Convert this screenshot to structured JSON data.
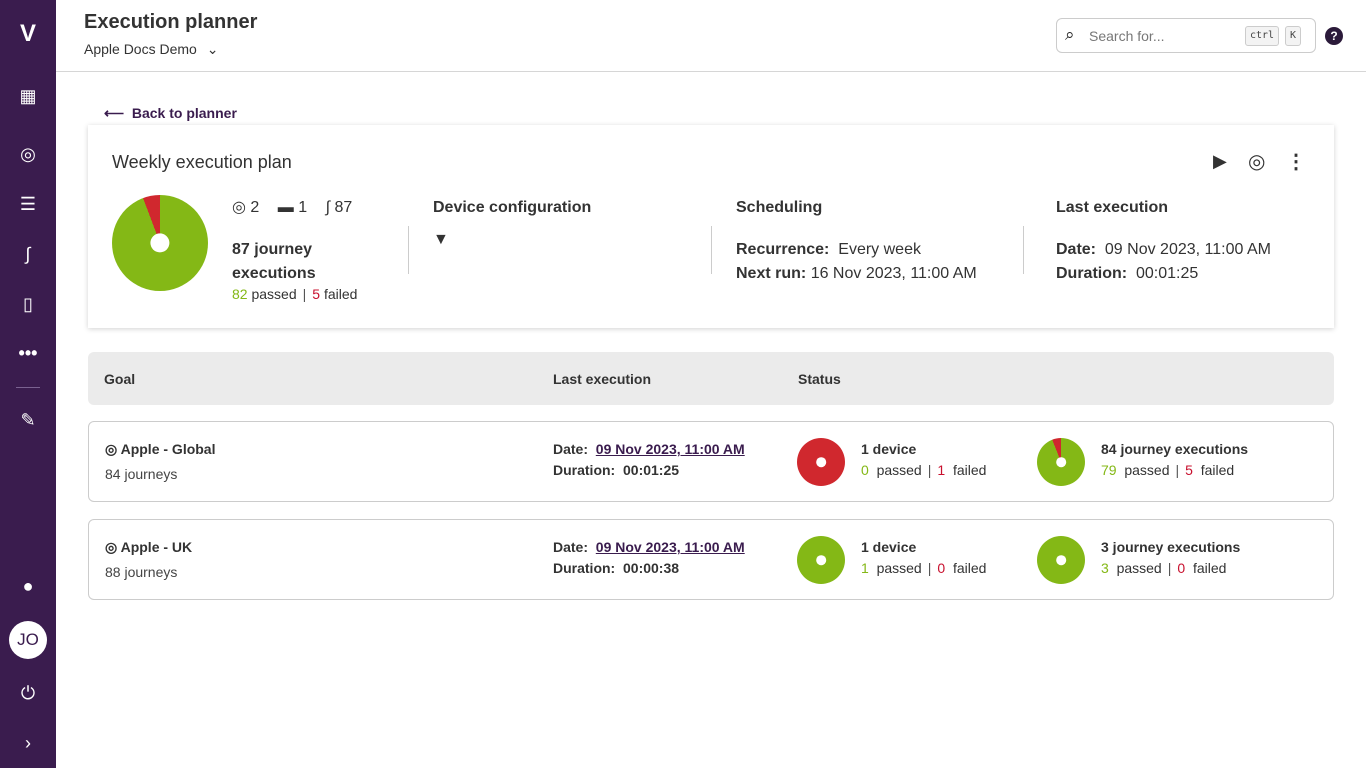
{
  "colors": {
    "sidebar": "#3a1c4e",
    "passed": "#84b816",
    "failed": "#d0282e"
  },
  "sidebar": {
    "items": [
      {
        "icon": "logo-icon"
      },
      {
        "icon": "organization-icon"
      },
      {
        "icon": "goal-icon"
      },
      {
        "icon": "list-icon"
      },
      {
        "icon": "journey-icon"
      },
      {
        "icon": "code-file-icon"
      },
      {
        "icon": "more-icon"
      },
      {
        "icon": "pin-icon"
      },
      {
        "icon": "chat-icon"
      },
      {
        "icon": "power-icon"
      },
      {
        "icon": "expand-icon"
      }
    ],
    "avatar": "JO"
  },
  "header": {
    "title": "Execution planner",
    "workspace": "Apple Docs Demo",
    "search_placeholder": "Search for...",
    "kbd1": "ctrl",
    "kbd2": "K",
    "help": "?"
  },
  "back": "Back to planner",
  "plan": {
    "title": "Weekly execution plan",
    "goals": "2",
    "devices": "1",
    "journeys": "87",
    "executions": "87 journey",
    "executions2": "executions",
    "passed": 82,
    "failed": 5,
    "passed_label": "passed",
    "failed_label": "failed",
    "device_config": "Device configuration",
    "scheduling": "Scheduling",
    "recurrence_label": "Recurrence:",
    "recurrence": "Every week",
    "next_label": "Next run:",
    "next": "16 Nov 2023, 11:00 AM",
    "last": "Last execution",
    "date_label": "Date:",
    "date": "09 Nov 2023, 11:00 AM",
    "duration_label": "Duration:",
    "duration": "00:01:25"
  },
  "table": {
    "headers": [
      "Goal",
      "Last execution",
      "Status"
    ],
    "rows": [
      {
        "goal": "Apple - Global",
        "journeys": "84 journeys",
        "date_label": "Date:",
        "date": "09 Nov 2023, 11:00 AM",
        "duration_label": "Duration:",
        "duration": "00:01:25",
        "devices": "1 device",
        "dev_passed": 0,
        "dev_failed": 1,
        "exec": "84 journey executions",
        "exec_passed": 79,
        "exec_failed": 5
      },
      {
        "goal": "Apple - UK",
        "journeys": "88 journeys",
        "date_label": "Date:",
        "date": "09 Nov 2023, 11:00 AM",
        "duration_label": "Duration:",
        "duration": "00:00:38",
        "devices": "1 device",
        "dev_passed": 1,
        "dev_failed": 0,
        "exec": "3 journey executions",
        "exec_passed": 3,
        "exec_failed": 0
      }
    ],
    "passed_label": "passed",
    "failed_label": "failed"
  }
}
